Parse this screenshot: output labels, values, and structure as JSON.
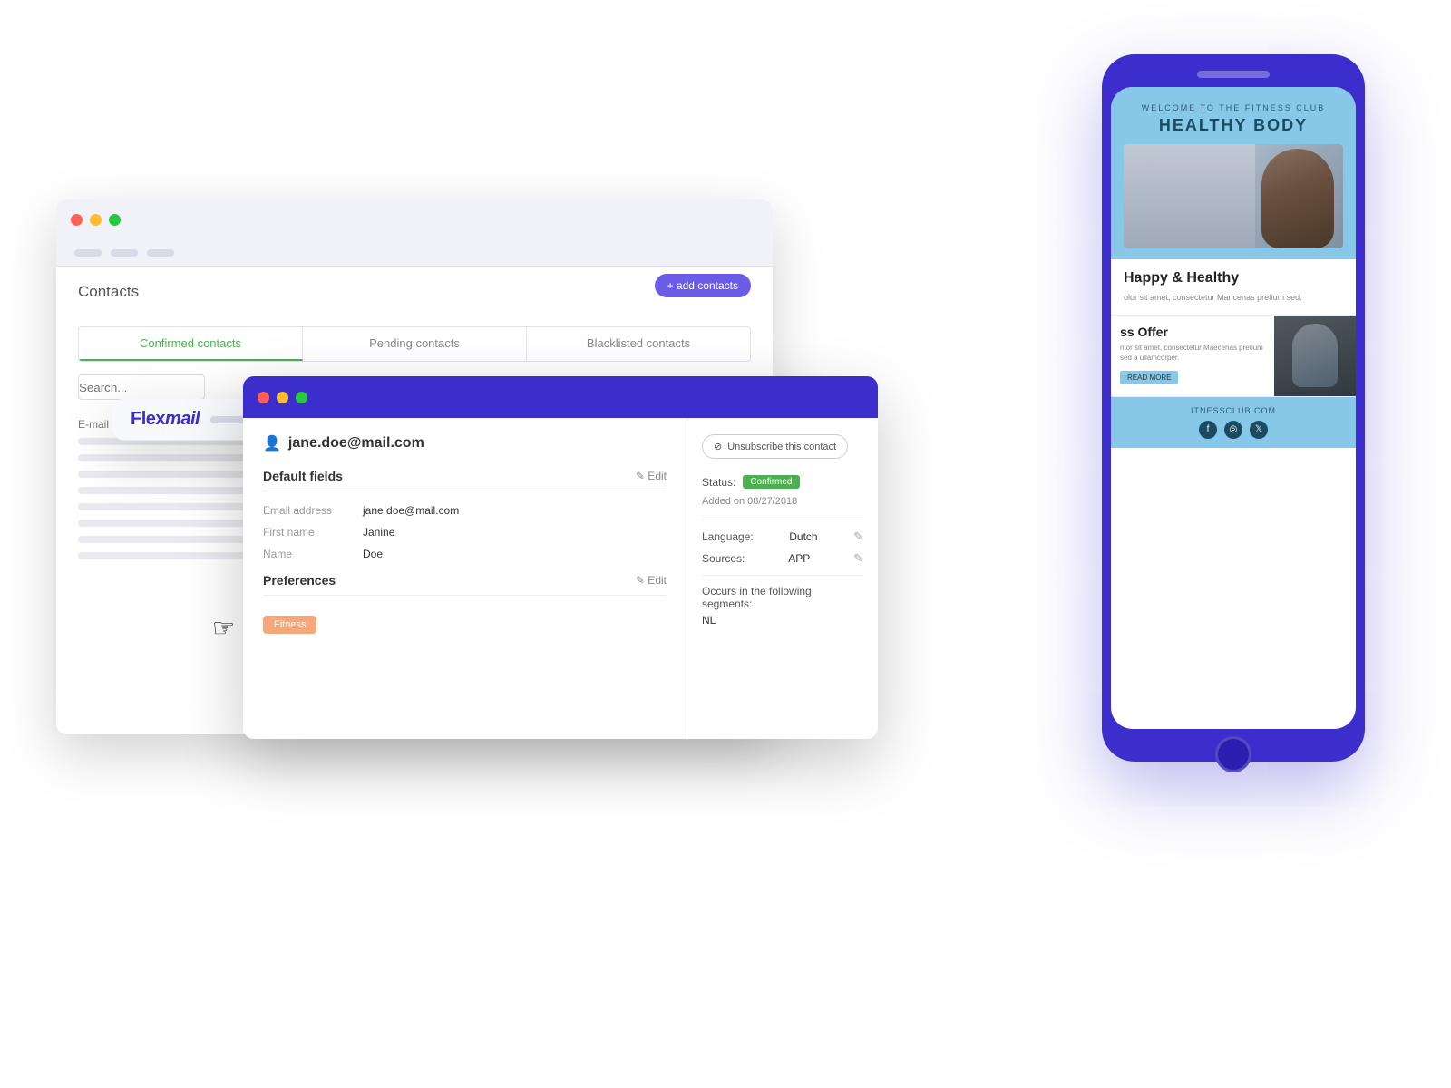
{
  "back_window": {
    "logo": "Flex",
    "logo_italic": "mail",
    "page_title": "Contacts",
    "add_btn": "+ add contacts",
    "tabs": [
      {
        "label": "Confirmed contacts",
        "active": true
      },
      {
        "label": "Pending contacts",
        "active": false
      },
      {
        "label": "Blacklisted contacts",
        "active": false
      }
    ],
    "col_email": "E-mail"
  },
  "mid_window": {
    "email": "jane.doe@mail.com",
    "unsubscribe_btn": "Unsubscribe this contact",
    "default_fields": {
      "title": "Default fields",
      "edit": "✎ Edit",
      "fields": [
        {
          "label": "Email address",
          "value": "jane.doe@mail.com"
        },
        {
          "label": "First name",
          "value": "Janine"
        },
        {
          "label": "Name",
          "value": "Doe"
        }
      ]
    },
    "preferences": {
      "title": "Preferences",
      "edit": "✎ Edit",
      "tag": "Fitness"
    },
    "status": {
      "label": "Status:",
      "badge": "Confirmed"
    },
    "added": "Added on 08/27/2018",
    "language": {
      "label": "Language:",
      "value": "Dutch"
    },
    "sources": {
      "label": "Sources:",
      "value": "APP"
    },
    "segments": {
      "label": "Occurs in the following segments:",
      "value": "NL"
    }
  },
  "phone": {
    "header_subtitle": "Welcome to the fitness club",
    "header_title": "HEALTHY BODY",
    "happy_title": "Happy & Healthy",
    "happy_text": "olor sit amet, consectetur\nMancenas pretium sed.",
    "offer_title": "ss Offer",
    "offer_text": "ntor sit amet, consectetur\nMaecenas pretium sed\na ullamcorper.",
    "read_more": "READ MORE",
    "footer_domain": "ITNESSCLUB.COM"
  }
}
